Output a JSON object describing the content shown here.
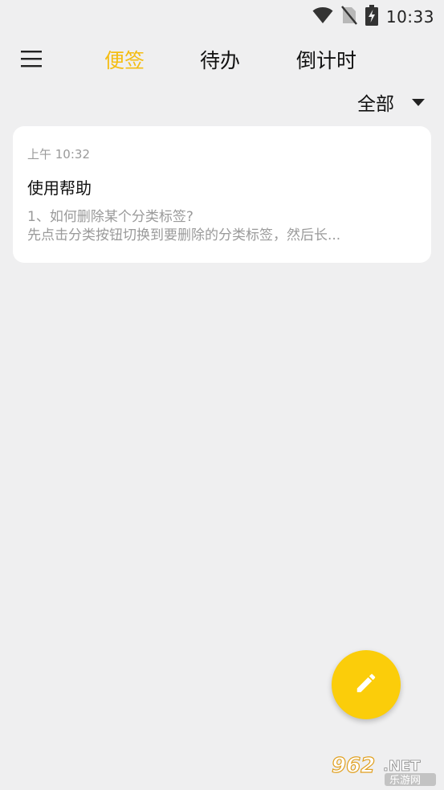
{
  "status_bar": {
    "time": "10:33",
    "icons": [
      "wifi-icon",
      "no-sim-icon",
      "battery-charging-icon"
    ]
  },
  "toolbar": {
    "menu_icon": "hamburger-menu-icon",
    "tabs": [
      {
        "label": "便签",
        "active": true
      },
      {
        "label": "待办",
        "active": false
      },
      {
        "label": "倒计时",
        "active": false
      }
    ],
    "accent_color": "#f4bd12"
  },
  "filter": {
    "selected": "全部",
    "icon": "dropdown-arrow-icon"
  },
  "notes": [
    {
      "time": "上午 10:32",
      "title": "使用帮助",
      "preview_line1": "1、如何删除某个分类标签?",
      "preview_line2": "先点击分类按钮切换到要删除的分类标签，然后长..."
    }
  ],
  "fab": {
    "icon": "edit-pencil-icon",
    "color": "#fbcd0a"
  },
  "watermark": {
    "brand_number": "962",
    "brand_suffix": ".NET",
    "brand_name": "乐游网"
  }
}
